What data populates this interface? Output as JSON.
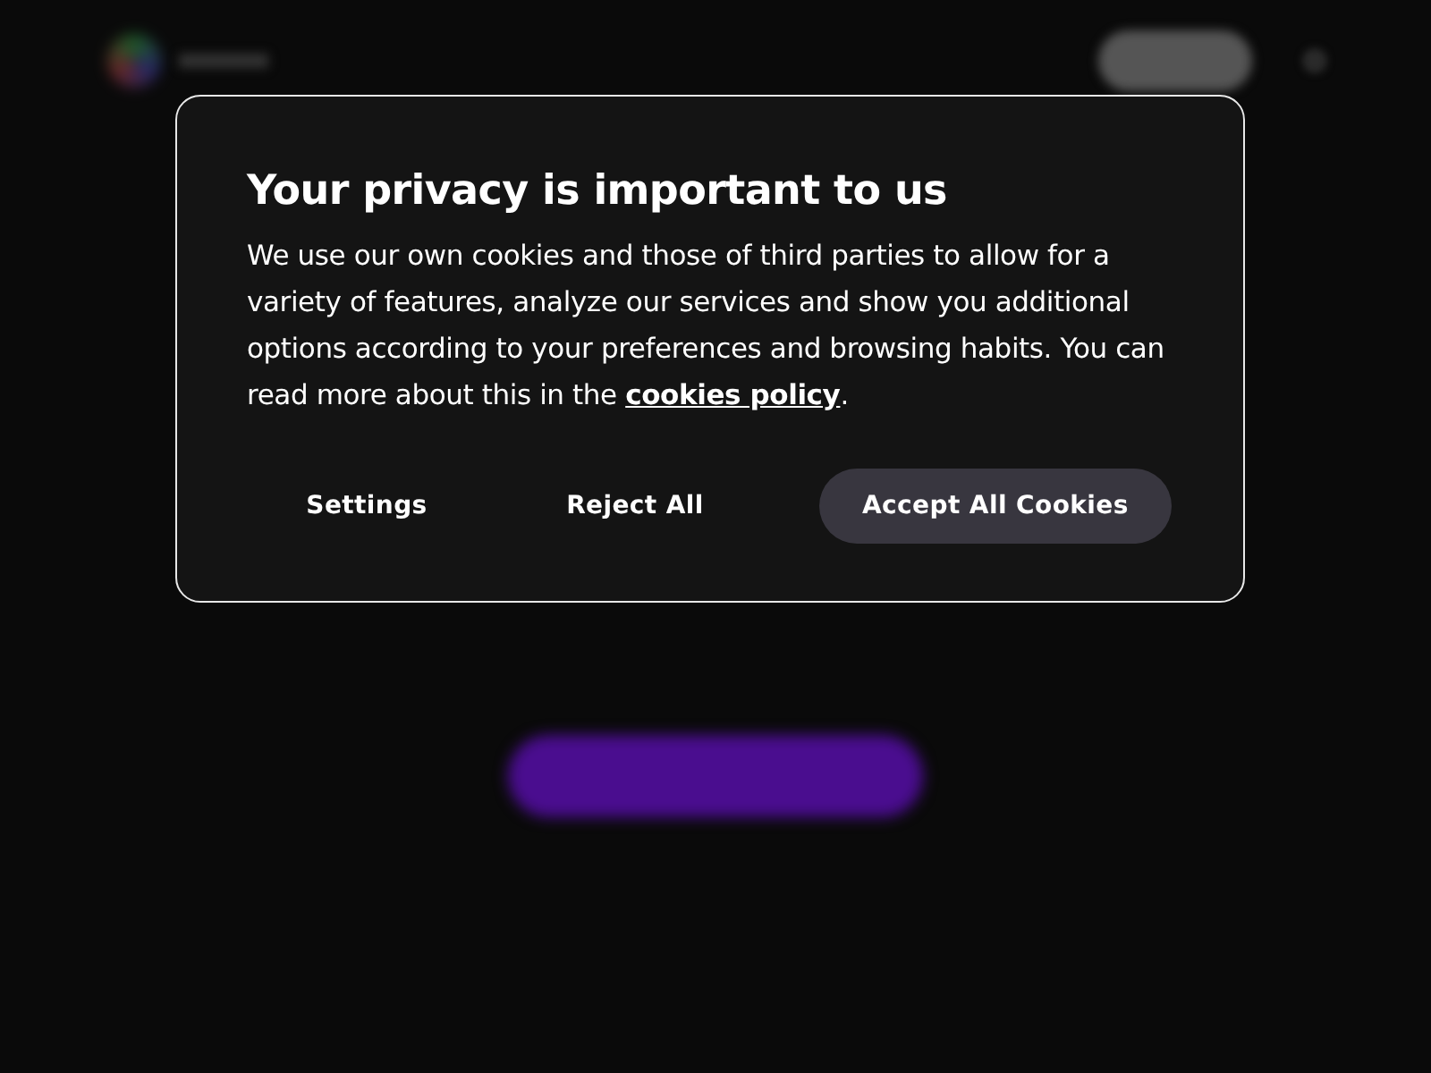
{
  "dialog": {
    "title": "Your privacy is important to us",
    "text_before": "We use our own cookies and those of third parties to allow for a variety of features, analyze our services and show you additional options according to your preferences and browsing habits. You can read more about this in the ",
    "link": "cookies policy",
    "text_after": ".",
    "buttons": [
      {
        "label": "Settings",
        "kind": "plain"
      },
      {
        "label": "Reject All",
        "kind": "plain"
      },
      {
        "label": "Accept All Cookies",
        "kind": "primary"
      }
    ]
  }
}
